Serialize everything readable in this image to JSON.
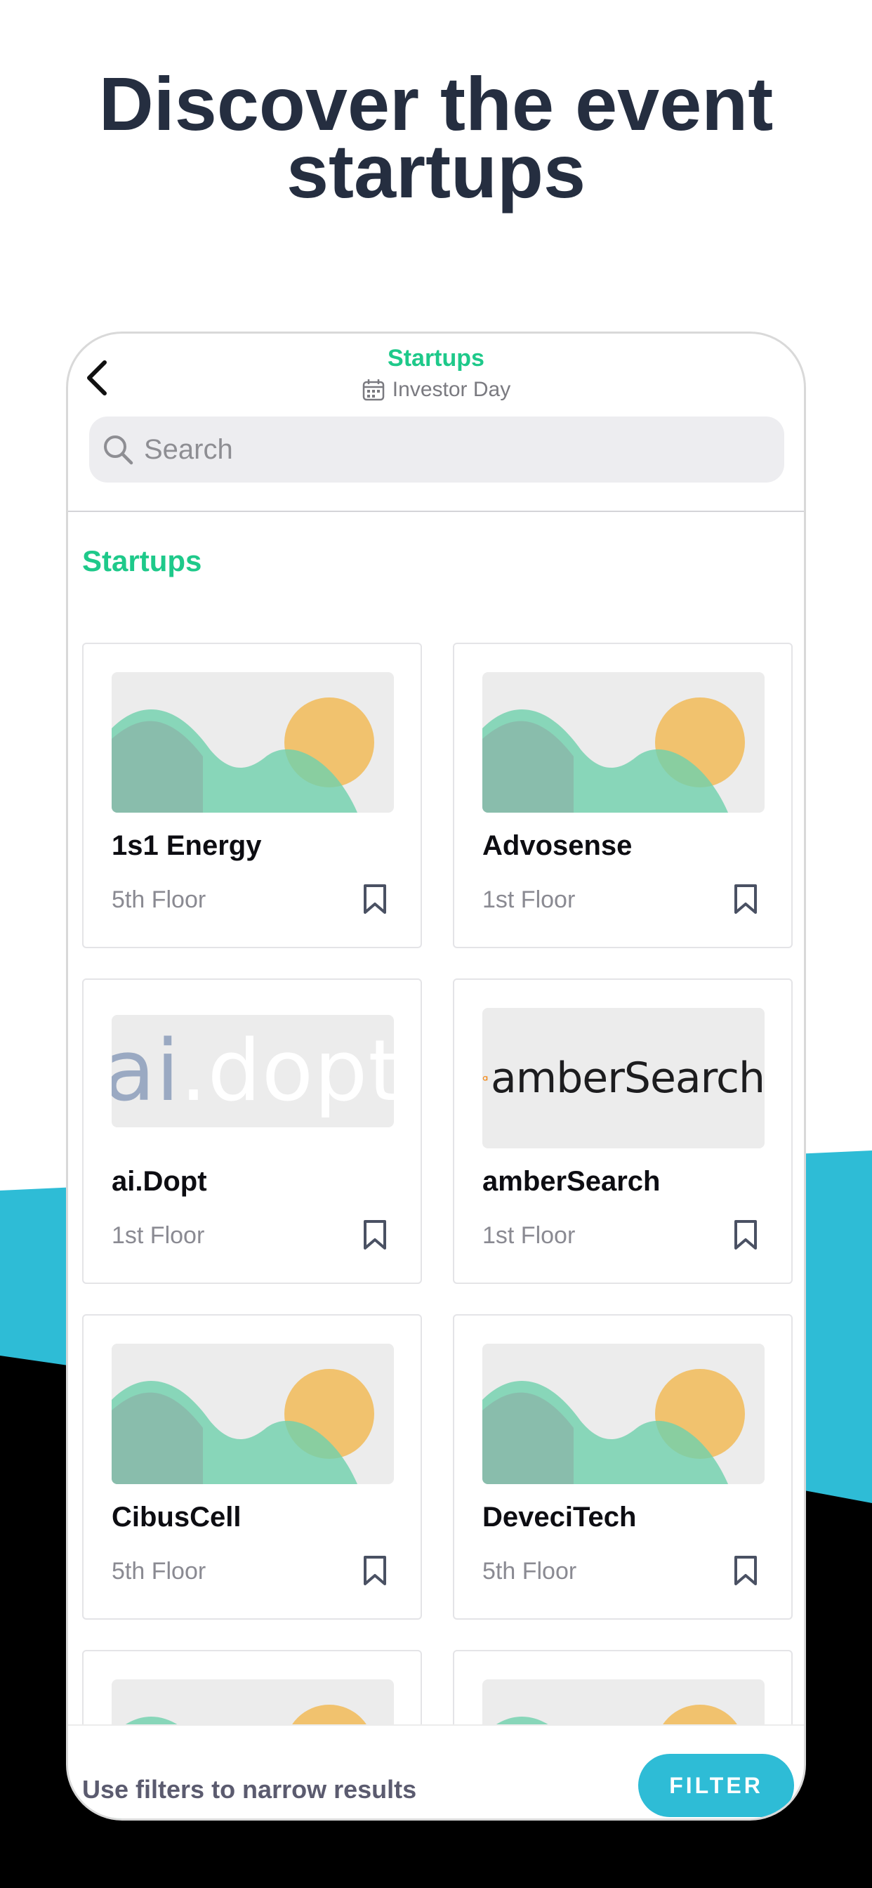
{
  "headline": {
    "line1": "Discover the event",
    "line2": "startups"
  },
  "nav": {
    "title": "Startups",
    "subtitle": "Investor Day"
  },
  "search": {
    "placeholder": "Search"
  },
  "section": {
    "title": "Startups"
  },
  "startups": [
    {
      "name": "1s1 Energy",
      "floor": "5th Floor",
      "logo": "placeholder-image"
    },
    {
      "name": "Advosense",
      "floor": "1st Floor",
      "logo": "placeholder-image"
    },
    {
      "name": "ai.Dopt",
      "floor": "1st Floor",
      "logo": "ai.dopt"
    },
    {
      "name": "amberSearch",
      "floor": "1st Floor",
      "logo": "amberSearch"
    },
    {
      "name": "CibusCell",
      "floor": "5th Floor",
      "logo": "placeholder-image"
    },
    {
      "name": "DeveciTech",
      "floor": "5th Floor",
      "logo": "placeholder-image"
    }
  ],
  "logos": {
    "aidopt_ai": "ai",
    "aidopt_rest": ".dopt",
    "amber_text": "amberSearch"
  },
  "bottom": {
    "hint": "Use filters to narrow results",
    "filter_label": "FILTER"
  },
  "colors": {
    "accent_green": "#1ec98a",
    "accent_cyan": "#2ebcd6",
    "headline": "#252e40",
    "band": "#2ebcd6"
  }
}
